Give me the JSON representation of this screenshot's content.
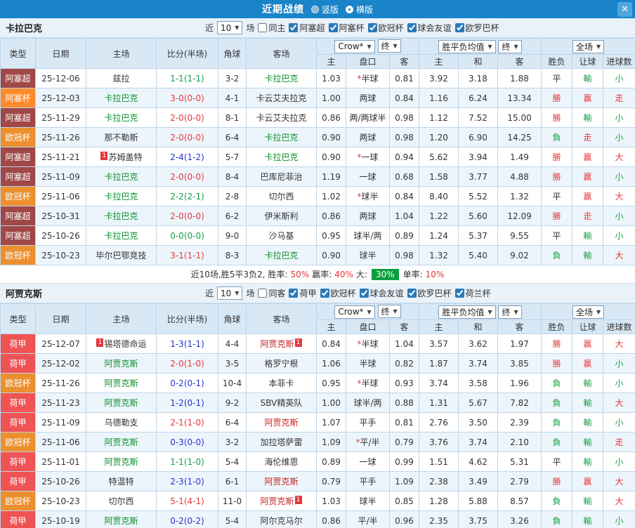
{
  "titlebar": {
    "title": "近期战绩",
    "radio_vertical": "竖版",
    "radio_horizontal": "横版",
    "selected": "横版",
    "close": "✕"
  },
  "filter_labels": {
    "near": "近",
    "matches": "场"
  },
  "table_controls": {
    "company": "Crow*",
    "closing": "终",
    "wdl_avg": "胜平负均值",
    "full": "全场"
  },
  "columns": {
    "type": "类型",
    "date": "日期",
    "home": "主场",
    "score": "比分(半场)",
    "corner": "角球",
    "away": "客场",
    "ah_home": "主",
    "handicap": "盘口",
    "ah_away": "客",
    "eu_home": "主",
    "eu_draw": "和",
    "eu_away": "客",
    "result": "胜负",
    "ah_result": "让球",
    "goals": "进球数"
  },
  "league_colors": {
    "阿塞超": "#a04747",
    "阿塞杯": "#ff8a2b",
    "欧冠杯": "#ec8f2f",
    "荷甲": "#ef5354"
  },
  "result_colors": {
    "勝": "red",
    "平": "dark",
    "負": "green",
    "赢": "red",
    "走": "red",
    "輸": "green",
    "大": "red",
    "小": "green"
  },
  "section1": {
    "team": "卡拉巴克",
    "count": "10",
    "same_label": "同主",
    "leagues": [
      "阿塞超",
      "阿塞杯",
      "欧冠杯",
      "球会友谊",
      "欧罗巴杯"
    ],
    "rows": [
      {
        "league": "阿塞超",
        "date": "25-12-06",
        "home": "兹拉",
        "score": "1-1(1-1)",
        "scoreColor": "green",
        "corners": "3-2",
        "away": "卡拉巴克",
        "awayColor": "green",
        "ahHome": "1.03",
        "handicap": "*半球",
        "ahAway": "0.81",
        "euHome": "3.92",
        "euDraw": "3.18",
        "euAway": "1.88",
        "result": "平",
        "ahResult": "輸",
        "ouResult": "小"
      },
      {
        "league": "阿塞杯",
        "date": "25-12-03",
        "home": "卡拉巴克",
        "homeColor": "green",
        "score": "3-0(0-0)",
        "scoreColor": "red",
        "corners": "4-1",
        "away": "卡云艾夫拉克",
        "ahHome": "1.00",
        "handicap": "两球",
        "ahAway": "0.84",
        "euHome": "1.16",
        "euDraw": "6.24",
        "euAway": "13.34",
        "result": "勝",
        "ahResult": "赢",
        "ouResult": "走"
      },
      {
        "league": "阿塞超",
        "date": "25-11-29",
        "home": "卡拉巴克",
        "homeColor": "green",
        "score": "2-0(0-0)",
        "scoreColor": "red",
        "corners": "8-1",
        "away": "卡云艾夫拉克",
        "ahHome": "0.86",
        "handicap": "两/两球半",
        "ahAway": "0.98",
        "euHome": "1.12",
        "euDraw": "7.52",
        "euAway": "15.00",
        "result": "勝",
        "ahResult": "輸",
        "ouResult": "小"
      },
      {
        "league": "欧冠杯",
        "date": "25-11-26",
        "home": "那不勒斯",
        "score": "2-0(0-0)",
        "scoreColor": "red",
        "corners": "6-4",
        "away": "卡拉巴克",
        "awayColor": "green",
        "ahHome": "0.90",
        "handicap": "两球",
        "ahAway": "0.98",
        "euHome": "1.20",
        "euDraw": "6.90",
        "euAway": "14.25",
        "result": "負",
        "ahResult": "走",
        "ouResult": "小"
      },
      {
        "league": "阿塞超",
        "date": "25-11-21",
        "home": "苏姆盖特",
        "homeBadge": "1",
        "score": "2-4(1-2)",
        "scoreColor": "blue",
        "corners": "5-7",
        "away": "卡拉巴克",
        "awayColor": "green",
        "ahHome": "0.90",
        "handicap": "*一球",
        "ahAway": "0.94",
        "euHome": "5.62",
        "euDraw": "3.94",
        "euAway": "1.49",
        "result": "勝",
        "ahResult": "赢",
        "ouResult": "大"
      },
      {
        "league": "阿塞超",
        "date": "25-11-09",
        "home": "卡拉巴克",
        "homeColor": "green",
        "score": "2-0(0-0)",
        "scoreColor": "red",
        "corners": "8-4",
        "away": "巴库尼菲治",
        "ahHome": "1.19",
        "handicap": "一球",
        "ahAway": "0.68",
        "euHome": "1.58",
        "euDraw": "3.77",
        "euAway": "4.88",
        "result": "勝",
        "ahResult": "赢",
        "ouResult": "小"
      },
      {
        "league": "欧冠杯",
        "date": "25-11-06",
        "home": "卡拉巴克",
        "homeColor": "green",
        "score": "2-2(2-1)",
        "scoreColor": "green",
        "corners": "2-8",
        "away": "切尔西",
        "ahHome": "1.02",
        "handicap": "*球半",
        "ahAway": "0.84",
        "euHome": "8.40",
        "euDraw": "5.52",
        "euAway": "1.32",
        "result": "平",
        "ahResult": "赢",
        "ouResult": "大"
      },
      {
        "league": "阿塞超",
        "date": "25-10-31",
        "home": "卡拉巴克",
        "homeColor": "green",
        "score": "2-0(0-0)",
        "scoreColor": "red",
        "corners": "6-2",
        "away": "伊米斯利",
        "ahHome": "0.86",
        "handicap": "两球",
        "ahAway": "1.04",
        "euHome": "1.22",
        "euDraw": "5.60",
        "euAway": "12.09",
        "result": "勝",
        "ahResult": "走",
        "ouResult": "小"
      },
      {
        "league": "阿塞超",
        "date": "25-10-26",
        "home": "卡拉巴克",
        "homeColor": "green",
        "score": "0-0(0-0)",
        "scoreColor": "green",
        "corners": "9-0",
        "away": "沙马基",
        "ahHome": "0.95",
        "handicap": "球半/两",
        "ahAway": "0.89",
        "euHome": "1.24",
        "euDraw": "5.37",
        "euAway": "9.55",
        "result": "平",
        "ahResult": "輸",
        "ouResult": "小"
      },
      {
        "league": "欧冠杯",
        "date": "25-10-23",
        "home": "毕尔巴鄂竞技",
        "score": "3-1(1-1)",
        "scoreColor": "red",
        "corners": "8-3",
        "away": "卡拉巴克",
        "awayColor": "green",
        "ahHome": "0.90",
        "handicap": "球半",
        "ahAway": "0.98",
        "euHome": "1.32",
        "euDraw": "5.40",
        "euAway": "9.02",
        "result": "負",
        "ahResult": "輸",
        "ouResult": "大"
      }
    ],
    "summary": {
      "prefix": "近10场,胜5平3负2,",
      "win_rate_label": "胜率:",
      "win_rate": "50%",
      "ah_rate_label": "赢率:",
      "ah_rate": "40%",
      "big_label": "大:",
      "big_rate": "30%",
      "single_label": "单率:",
      "single_rate": "10%"
    }
  },
  "section2": {
    "team": "阿贾克斯",
    "count": "10",
    "same_label": "同客",
    "leagues": [
      "荷甲",
      "欧冠杯",
      "球会友谊",
      "欧罗巴杯",
      "荷兰杯"
    ],
    "rows": [
      {
        "league": "荷甲",
        "date": "25-12-07",
        "home": "锡塔德命运",
        "homeBadge": "1",
        "score": "1-3(1-1)",
        "scoreColor": "blue",
        "corners": "4-4",
        "away": "阿贾克斯",
        "awayColor": "red",
        "awayBadge": "1",
        "ahHome": "0.84",
        "handicap": "*半球",
        "ahAway": "1.04",
        "euHome": "3.57",
        "euDraw": "3.62",
        "euAway": "1.97",
        "result": "勝",
        "ahResult": "赢",
        "ouResult": "大"
      },
      {
        "league": "荷甲",
        "date": "25-12-02",
        "home": "阿贾克斯",
        "homeColor": "green",
        "score": "2-0(1-0)",
        "scoreColor": "red",
        "corners": "3-5",
        "away": "格罗宁根",
        "ahHome": "1.06",
        "handicap": "半球",
        "ahAway": "0.82",
        "euHome": "1.87",
        "euDraw": "3.74",
        "euAway": "3.85",
        "result": "勝",
        "ahResult": "赢",
        "ouResult": "小"
      },
      {
        "league": "欧冠杯",
        "date": "25-11-26",
        "home": "阿贾克斯",
        "homeColor": "green",
        "score": "0-2(0-1)",
        "scoreColor": "blue",
        "corners": "10-4",
        "away": "本菲卡",
        "ahHome": "0.95",
        "handicap": "*半球",
        "ahAway": "0.93",
        "euHome": "3.74",
        "euDraw": "3.58",
        "euAway": "1.96",
        "result": "負",
        "ahResult": "輸",
        "ouResult": "小"
      },
      {
        "league": "荷甲",
        "date": "25-11-23",
        "home": "阿贾克斯",
        "homeColor": "green",
        "score": "1-2(0-1)",
        "scoreColor": "blue",
        "corners": "9-2",
        "away": "SBV精英队",
        "ahHome": "1.00",
        "handicap": "球半/两",
        "ahAway": "0.88",
        "euHome": "1.31",
        "euDraw": "5.67",
        "euAway": "7.82",
        "result": "負",
        "ahResult": "輸",
        "ouResult": "大"
      },
      {
        "league": "荷甲",
        "date": "25-11-09",
        "home": "乌德勒支",
        "score": "2-1(1-0)",
        "scoreColor": "red",
        "corners": "6-4",
        "away": "阿贾克斯",
        "awayColor": "red",
        "ahHome": "1.07",
        "handicap": "平手",
        "ahAway": "0.81",
        "euHome": "2.76",
        "euDraw": "3.50",
        "euAway": "2.39",
        "result": "負",
        "ahResult": "輸",
        "ouResult": "小"
      },
      {
        "league": "欧冠杯",
        "date": "25-11-06",
        "home": "阿贾克斯",
        "homeColor": "green",
        "score": "0-3(0-0)",
        "scoreColor": "blue",
        "corners": "3-2",
        "away": "加拉塔萨雷",
        "ahHome": "1.09",
        "handicap": "*平/半",
        "ahAway": "0.79",
        "euHome": "3.76",
        "euDraw": "3.74",
        "euAway": "2.10",
        "result": "負",
        "ahResult": "輸",
        "ouResult": "走"
      },
      {
        "league": "荷甲",
        "date": "25-11-01",
        "home": "阿贾克斯",
        "homeColor": "green",
        "score": "1-1(1-0)",
        "scoreColor": "green",
        "corners": "5-4",
        "away": "海伦维恩",
        "ahHome": "0.89",
        "handicap": "一球",
        "ahAway": "0.99",
        "euHome": "1.51",
        "euDraw": "4.62",
        "euAway": "5.31",
        "result": "平",
        "ahResult": "輸",
        "ouResult": "小"
      },
      {
        "league": "荷甲",
        "date": "25-10-26",
        "home": "特温特",
        "score": "2-3(1-0)",
        "scoreColor": "blue",
        "corners": "6-1",
        "away": "阿贾克斯",
        "awayColor": "red",
        "ahHome": "0.79",
        "handicap": "平手",
        "ahAway": "1.09",
        "euHome": "2.38",
        "euDraw": "3.49",
        "euAway": "2.79",
        "result": "勝",
        "ahResult": "赢",
        "ouResult": "大"
      },
      {
        "league": "欧冠杯",
        "date": "25-10-23",
        "home": "切尔西",
        "score": "5-1(4-1)",
        "scoreColor": "red",
        "corners": "11-0",
        "away": "阿贾克斯",
        "awayColor": "red",
        "awayBadge": "1",
        "ahHome": "1.03",
        "handicap": "球半",
        "ahAway": "0.85",
        "euHome": "1.28",
        "euDraw": "5.88",
        "euAway": "8.57",
        "result": "負",
        "ahResult": "輸",
        "ouResult": "大"
      },
      {
        "league": "荷甲",
        "date": "25-10-19",
        "home": "阿贾克斯",
        "homeColor": "green",
        "score": "0-2(0-2)",
        "scoreColor": "blue",
        "corners": "5-4",
        "away": "阿尔克马尔",
        "ahHome": "0.86",
        "handicap": "平/半",
        "ahAway": "0.96",
        "euHome": "2.35",
        "euDraw": "3.75",
        "euAway": "3.26",
        "result": "負",
        "ahResult": "輸",
        "ouResult": "小"
      }
    ]
  }
}
